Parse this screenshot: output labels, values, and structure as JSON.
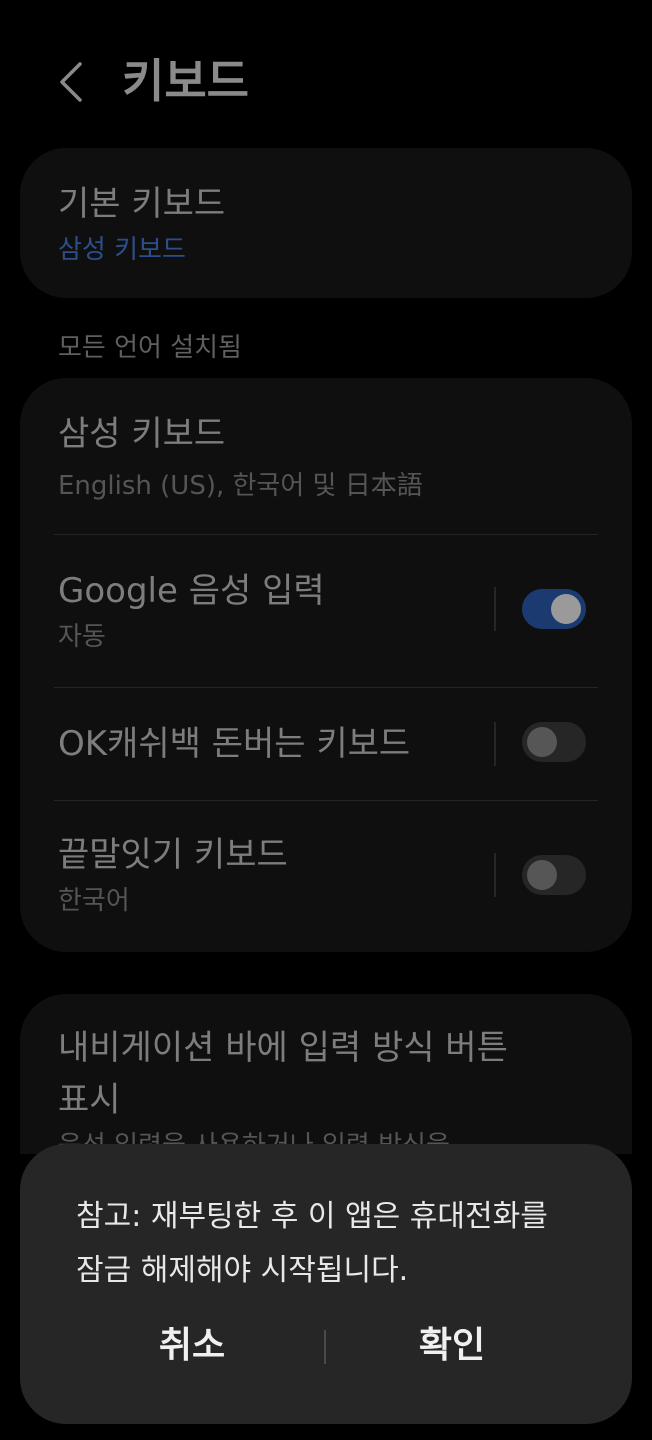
{
  "header": {
    "back_icon": "chevron-left-icon",
    "title": "키보드"
  },
  "default_keyboard": {
    "title": "기본 키보드",
    "value": "삼성 키보드"
  },
  "section_header": "모든 언어 설치됨",
  "keyboards": [
    {
      "title": "삼성 키보드",
      "subtitle": "English (US), 한국어 및 日本語"
    },
    {
      "title": "Google 음성 입력",
      "subtitle": "자동",
      "toggle": true
    },
    {
      "title": "OK캐쉬백 돈버는 키보드",
      "toggle": false
    },
    {
      "title": "끝말잇기 키보드",
      "subtitle": "한국어",
      "toggle": false
    }
  ],
  "nav_setting": {
    "title_line1": "내비게이션 바에 입력 방식 버튼",
    "title_line2": "표시",
    "subtitle_partial": "음성 입력을 사용하거나 입력 방식을"
  },
  "dialog": {
    "message": "참고: 재부팅한 후 이 앱은 휴대전화를 잠금 해제해야 시작됩니다.",
    "cancel_label": "취소",
    "ok_label": "확인"
  },
  "colors": {
    "background": "#000000",
    "card": "#0f0f0f",
    "dialog": "#262626",
    "accent": "#2c4f8c",
    "toggle_on": "#1b3a70"
  }
}
